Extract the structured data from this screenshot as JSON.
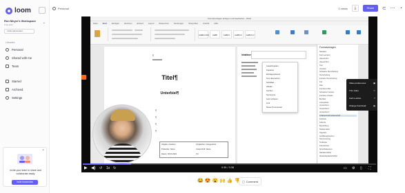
{
  "brand": {
    "name": "loom",
    "accent": "#625df5"
  },
  "workspace": {
    "name": "Ron Meyer's Workspace",
    "subtitle": "Free plan",
    "invite_label": "Invite teammates"
  },
  "sidebar": {
    "section_label": "Libraries",
    "items": [
      {
        "label": "Personal",
        "icon": "person-icon"
      },
      {
        "label": "Shared with me",
        "icon": "people-icon"
      },
      {
        "label": "Team",
        "icon": "team-icon"
      }
    ],
    "items2": [
      {
        "label": "Starred",
        "icon": "star-icon"
      },
      {
        "label": "Archived",
        "icon": "archive-icon"
      },
      {
        "label": "Settings",
        "icon": "gear-icon"
      }
    ],
    "promo": {
      "text": "Invite your team to share and collaborate easily",
      "button": "Invite teammates"
    }
  },
  "topbar": {
    "breadcrumb": "Personal",
    "views": "0 views",
    "share_label": "Share"
  },
  "document": {
    "window_title": "Formatvorlagen anlegen und bearbeiten - Word",
    "menu": [
      "Datei",
      "Start",
      "Einfügen",
      "Zeichnen",
      "Entwurf",
      "Layout",
      "Referenzen",
      "Sendungen",
      "Überprüfen",
      "Ansicht",
      "Hilfe"
    ],
    "styles": [
      "AaBbCcDd",
      "AaBb",
      "AaBbC",
      "AaBbCc",
      "AaBbCcI"
    ],
    "title_text": "Titel¶",
    "subtitle_text": "Unterbiel¶",
    "page_b_heading": "Inhaltsverzeichnis¶",
    "context_items": [
      "Ausschneiden",
      "Kopieren",
      "Einfügeoptionen:",
      "Text übersetzen",
      "Schriftart...",
      "Absatz...",
      "Suchen",
      "Synonyme",
      "Laut vorlesen",
      "Link",
      "Neuer Kommentar"
    ],
    "table_cells": [
      "Abgabe: Ansehen",
      "Vergleichen: Ausgewertet",
      "Prüfender: Name",
      "Unterschrift: Name",
      "Datum: 00.00.2024",
      "Ort"
    ],
    "format_panel": {
      "title": "Formatvorlagen",
      "rows": [
        "Standard",
        "Kein Leerraum",
        "Überschrift 1",
        "Überschrift 2",
        "Titel",
        "Untertitel",
        "Schwache Hervorhebung",
        "Hervorhebung",
        "Intensive Hervorhebung",
        "Fett",
        "Zitat",
        "Intensives Zitat",
        "Schwacher Verweis",
        "Intensiver Verweis",
        "Buchtitel",
        "Listenabsatz",
        "Verzeichnis 1",
        "Verzeichnis 2",
        "Verzeichnis 3",
        "Inhaltsverzeichnisüberschrift",
        "Kopfzeile",
        "Fußzeile",
        "Beschriftung",
        "Tabellenraster",
        "Hyperlink",
        "Aufzählungszeichen",
        "Nummerierung",
        "Textkörper",
        "Fußnotentext",
        "Sprechblasentext",
        "Standard (Web)",
        "Absatzstandardschriftart"
      ]
    }
  },
  "video_menu": {
    "items": [
      {
        "label": "Video preferences",
        "icon": "settings-icon"
      },
      {
        "label": "Trim video",
        "icon": "scissors-icon"
      },
      {
        "label": "Call to action",
        "icon": "link-icon"
      },
      {
        "label": "Change thumbnail",
        "icon": "image-icon"
      }
    ]
  },
  "player": {
    "time": "0:36 / 3:38",
    "progress": 0.165,
    "speed": "1x"
  },
  "reactions": [
    "😂",
    "😍",
    "😮",
    "🙌",
    "👍",
    "👎"
  ],
  "comment_label": "Comment"
}
